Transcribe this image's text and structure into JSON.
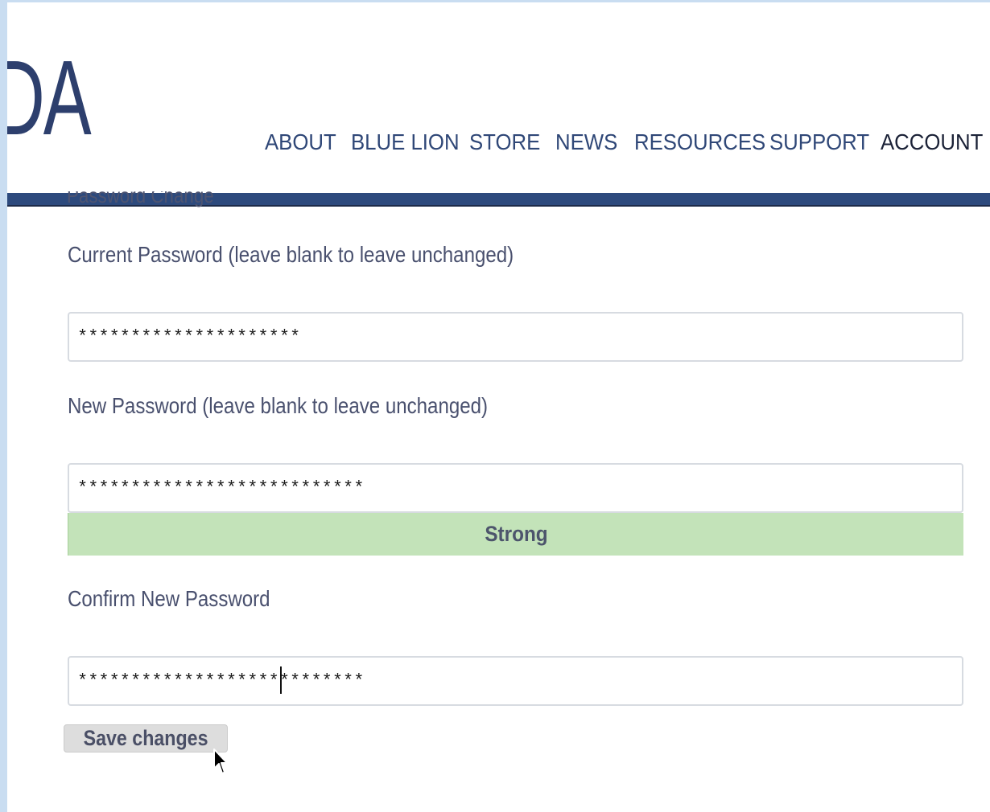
{
  "brand": {
    "logo_text": "DAE"
  },
  "nav": {
    "items": [
      {
        "label": "ABOUT"
      },
      {
        "label": "BLUE LION"
      },
      {
        "label": "STORE"
      },
      {
        "label": "NEWS"
      },
      {
        "label": "RESOURCES"
      },
      {
        "label": "SUPPORT"
      },
      {
        "label": "ACCOUNT",
        "active": true
      }
    ]
  },
  "form": {
    "section_title": "Password Change",
    "current_password": {
      "label": "Current Password (leave blank to leave unchanged)",
      "value": "*********************"
    },
    "new_password": {
      "label": "New Password (leave blank to leave unchanged)",
      "value": "***************************",
      "strength": "Strong"
    },
    "confirm_password": {
      "label": "Confirm New Password",
      "value": "***************************"
    },
    "save_label": "Save changes"
  },
  "colors": {
    "frame": "#c9ddf1",
    "brand": "#2d4a7d",
    "strength_fill": "#c3e3b9",
    "text": "#49506e"
  },
  "icons": {
    "cursor": "mouse-pointer-icon"
  }
}
